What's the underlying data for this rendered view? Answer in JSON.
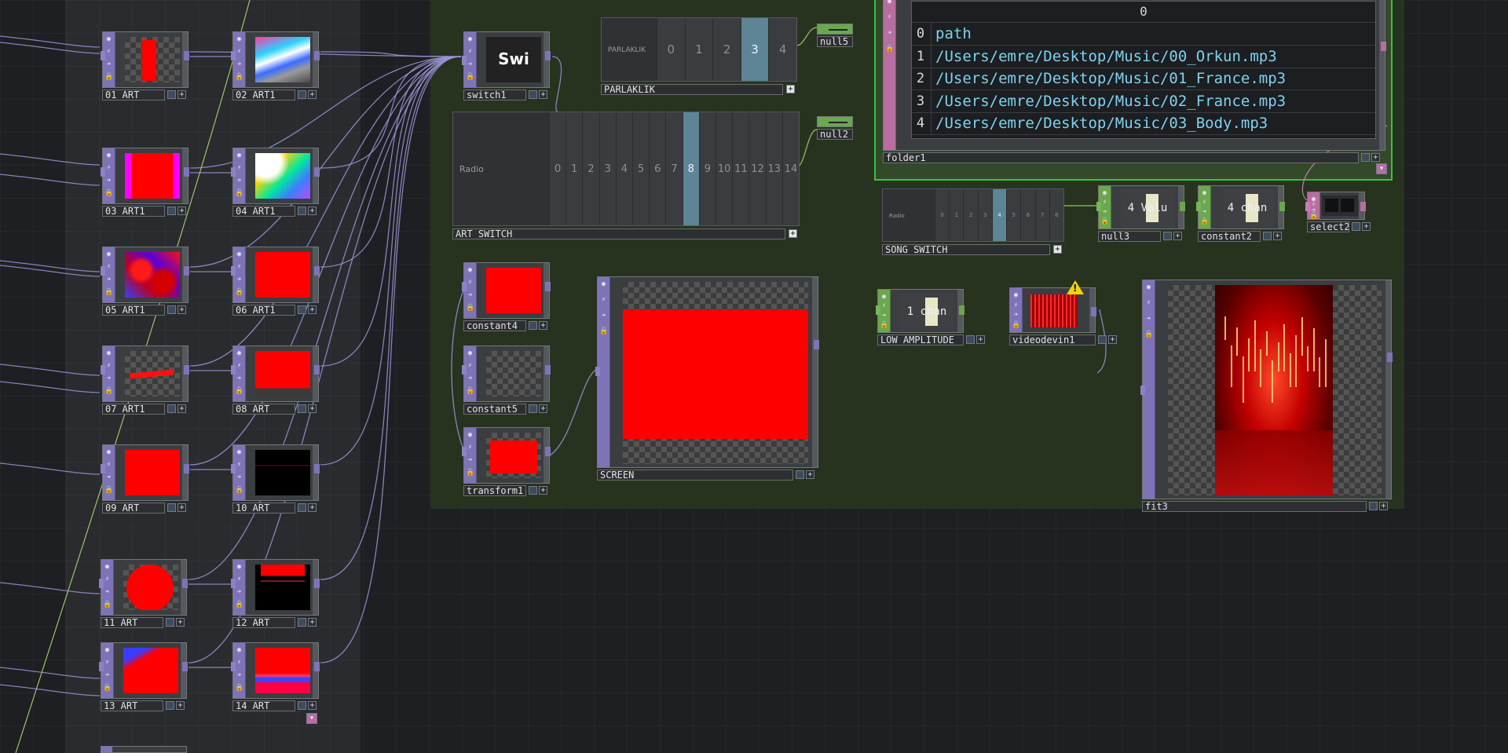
{
  "app": {
    "name": "TouchDesigner network editor"
  },
  "colors": {
    "top_family": "#7f73b8",
    "chop_family": "#6aa74e",
    "dat_family": "#b86ea1",
    "selected_frame": "#35c435",
    "radio_active": "#5d8596",
    "table_text": "#7fd2ef"
  },
  "icons": {
    "viewer_toggle": "circle-dot-icon",
    "bypass": "lightning-icon",
    "cook": "arrow-right-icon",
    "lock": "lock-icon",
    "expand": "plus-icon",
    "warning": "warning-icon"
  },
  "art_nodes": [
    {
      "name": "01_ART"
    },
    {
      "name": "02_ART1"
    },
    {
      "name": "03_ART1"
    },
    {
      "name": "04_ART1"
    },
    {
      "name": "05_ART1"
    },
    {
      "name": "06_ART1"
    },
    {
      "name": "07_ART1"
    },
    {
      "name": "08_ART"
    },
    {
      "name": "09_ART"
    },
    {
      "name": "10_ART"
    },
    {
      "name": "11_ART"
    },
    {
      "name": "12_ART"
    },
    {
      "name": "13_ART"
    },
    {
      "name": "14_ART"
    }
  ],
  "switch1": {
    "name": "switch1",
    "preview_text": "Swi"
  },
  "parlaklik": {
    "name": "PARLAKLIK",
    "panel_label": "PARLAKLIK",
    "options": [
      "0",
      "1",
      "2",
      "3",
      "4"
    ],
    "selected": "3"
  },
  "art_switch": {
    "name": "ART_SWITCH",
    "panel_label": "Radio",
    "options": [
      "0",
      "1",
      "2",
      "3",
      "4",
      "5",
      "6",
      "7",
      "8",
      "9",
      "10",
      "11",
      "12",
      "13",
      "14"
    ],
    "selected": "8"
  },
  "song_switch": {
    "name": "SONG_SWITCH",
    "panel_label": "Radio",
    "options": [
      "0",
      "1",
      "2",
      "3",
      "4",
      "5",
      "6",
      "7",
      "8"
    ],
    "selected": "4"
  },
  "null5": {
    "name": "null5"
  },
  "null2": {
    "name": "null2"
  },
  "folder1": {
    "name": "folder1",
    "header": "0",
    "rows": [
      {
        "index": "0",
        "value": "path"
      },
      {
        "index": "1",
        "value": "/Users/emre/Desktop/Music/00_Orkun.mp3"
      },
      {
        "index": "2",
        "value": "/Users/emre/Desktop/Music/01_France.mp3"
      },
      {
        "index": "3",
        "value": "/Users/emre/Desktop/Music/02_France.mp3"
      },
      {
        "index": "4",
        "value": "/Users/emre/Desktop/Music/03_Body.mp3"
      }
    ]
  },
  "null3": {
    "name": "null3",
    "preview_text": "4 Valu"
  },
  "constant2": {
    "name": "constant2",
    "preview_text": "4 chan"
  },
  "select2": {
    "name": "select2"
  },
  "constant4": {
    "name": "constant4"
  },
  "constant5": {
    "name": "constant5"
  },
  "transform1": {
    "name": "transform1"
  },
  "screen": {
    "name": "SCREEN"
  },
  "low_amplitude": {
    "name": "LOW_AMPLITUDE",
    "preview_text": "1 chan"
  },
  "videodevin1": {
    "name": "videodevin1"
  },
  "fit3": {
    "name": "fit3"
  }
}
